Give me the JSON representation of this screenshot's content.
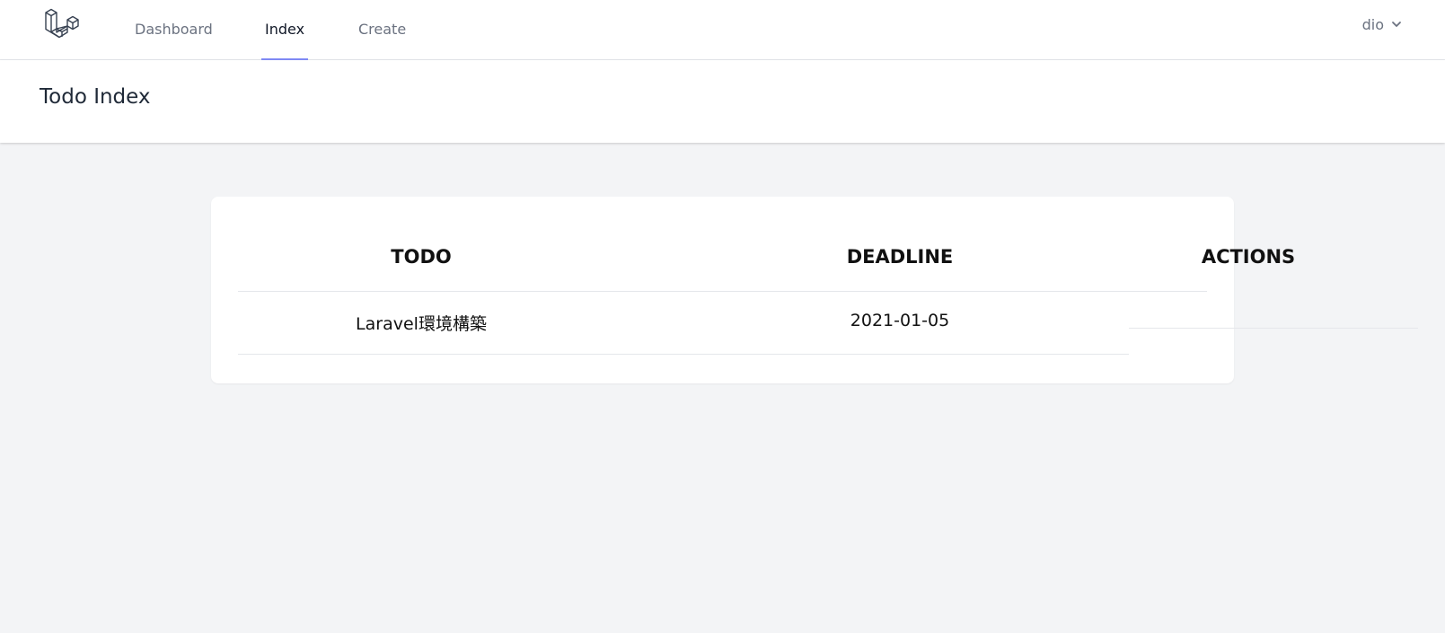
{
  "nav": {
    "links": [
      {
        "label": "Dashboard"
      },
      {
        "label": "Index"
      },
      {
        "label": "Create"
      }
    ],
    "active": "Index",
    "user": {
      "name": "dio"
    }
  },
  "header": {
    "title": "Todo Index"
  },
  "table": {
    "headers": {
      "todo": "TODO",
      "deadline": "DEADLINE",
      "actions": "ACTIONS"
    },
    "rows": [
      {
        "todo": "Laravel環境構築",
        "deadline": "2021-01-05"
      }
    ]
  },
  "colors": {
    "page_background": "#f3f4f6",
    "active_underline": "#818cf8",
    "nav_text": "#6b7280"
  },
  "icons": {
    "logo": "laravel-logo-icon",
    "dropdown": "chevron-down-icon"
  }
}
